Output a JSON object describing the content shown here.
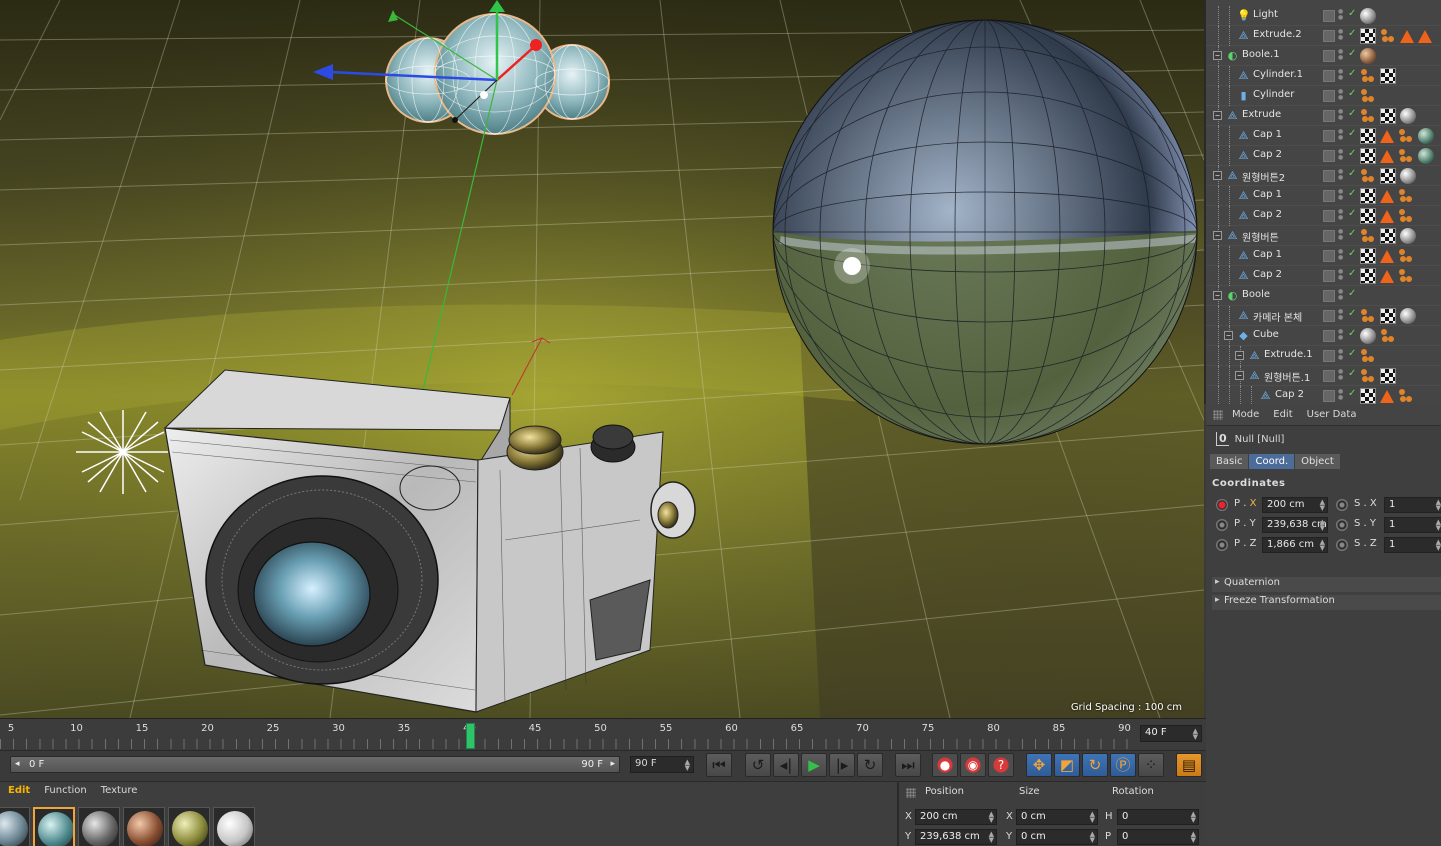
{
  "viewport": {
    "grid_spacing": "Grid Spacing : 100 cm"
  },
  "object_manager": {
    "rows": [
      {
        "name": "Light",
        "icon": "light-icon"
      },
      {
        "name": "Extrude.2",
        "icon": "extrude-icon"
      },
      {
        "name": "Boole.1",
        "icon": "boole-icon"
      },
      {
        "name": "Cylinder.1",
        "icon": "extrude-icon"
      },
      {
        "name": "Cylinder",
        "icon": "cylinder-icon"
      },
      {
        "name": "Extrude",
        "icon": "extrude-icon"
      },
      {
        "name": "Cap 1",
        "icon": "extrude-icon"
      },
      {
        "name": "Cap 2",
        "icon": "extrude-icon"
      },
      {
        "name": "원형버튼2",
        "icon": "extrude-icon"
      },
      {
        "name": "Cap 1",
        "icon": "extrude-icon"
      },
      {
        "name": "Cap 2",
        "icon": "extrude-icon"
      },
      {
        "name": "원형버튼",
        "icon": "extrude-icon"
      },
      {
        "name": "Cap 1",
        "icon": "extrude-icon"
      },
      {
        "name": "Cap 2",
        "icon": "extrude-icon"
      },
      {
        "name": "Boole",
        "icon": "boole-icon"
      },
      {
        "name": "카메라 본체",
        "icon": "extrude-icon"
      },
      {
        "name": "Cube",
        "icon": "cube-icon"
      },
      {
        "name": "Extrude.1",
        "icon": "extrude-icon"
      },
      {
        "name": "원형버튼.1",
        "icon": "extrude-icon"
      },
      {
        "name": "Cap 2",
        "icon": "extrude-icon"
      }
    ]
  },
  "attributes": {
    "menu": [
      "Mode",
      "Edit",
      "User Data"
    ],
    "object_title": "Null [Null]",
    "tabs": [
      "Basic",
      "Coord.",
      "Object"
    ],
    "active_tab": "Coord.",
    "section": "Coordinates",
    "coords": [
      {
        "label_prefix": "P . ",
        "axis": "X",
        "value": "200 cm",
        "scale_label": "S . X",
        "scale_value": "1"
      },
      {
        "label_prefix": "P . ",
        "axis": "Y",
        "value": "239,638 cm",
        "scale_label": "S . Y",
        "scale_value": "1"
      },
      {
        "label_prefix": "P . ",
        "axis": "Z",
        "value": "1,866 cm",
        "scale_label": "S . Z",
        "scale_value": "1"
      }
    ],
    "folds": [
      "Quaternion",
      "Freeze Transformation"
    ]
  },
  "timeline": {
    "ticks": [
      "5",
      "10",
      "15",
      "20",
      "25",
      "30",
      "35",
      "40",
      "45",
      "50",
      "55",
      "60",
      "65",
      "70",
      "75",
      "80",
      "85",
      "90"
    ],
    "current_frame": "40 F",
    "current_frame_value": 40
  },
  "transport": {
    "range_start": "0 F",
    "range_end": "90 F",
    "end_frame": "90 F"
  },
  "material_manager": {
    "menu": [
      "Edit",
      "Function",
      "Texture"
    ]
  },
  "coordinate_manager": {
    "headers": [
      "Position",
      "Size",
      "Rotation"
    ],
    "rows": [
      {
        "axis": "X",
        "position": "200 cm",
        "size_axis": "X",
        "size": "0 cm",
        "rot_axis": "H",
        "rotation": "0"
      },
      {
        "axis": "Y",
        "position": "239,638 cm",
        "size_axis": "Y",
        "size": "0 cm",
        "rot_axis": "P",
        "rotation": "0"
      }
    ]
  },
  "colors": {
    "accent": "#f0a43a",
    "active_tab": "#4c6c9a",
    "playhead": "#2fc46a"
  }
}
